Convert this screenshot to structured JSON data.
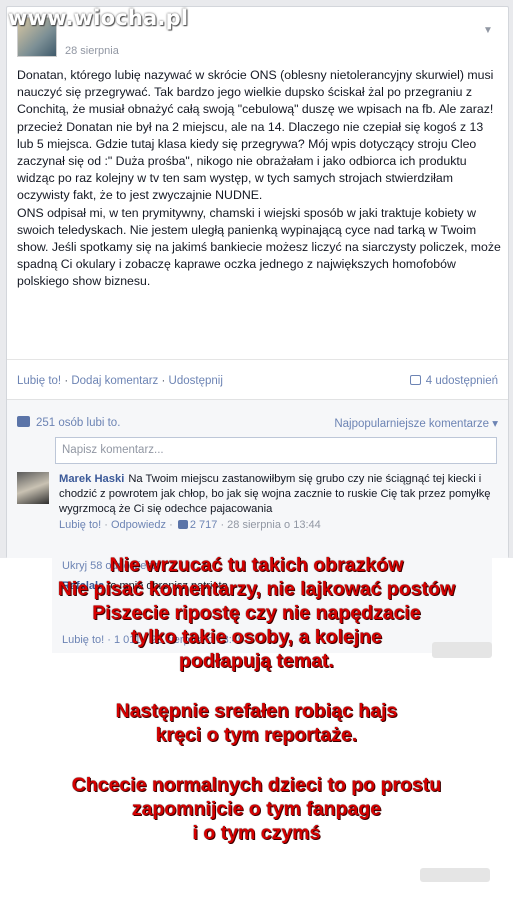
{
  "watermark": "www.wiocha.pl",
  "post": {
    "date": "28 sierpnia",
    "paragraphs": [
      "Donatan, którego lubię nazywać w skrócie ONS (oblesny nietolerancyjny skurwiel) musi nauczyć się przegrywać. Tak bardzo jego wielkie dupsko ściskał żal po przegraniu z Conchitą, że musiał obnażyć całą swoją \"cebulową\" duszę we wpisach na fb. Ale zaraz! przecież Donatan nie był na 2 miejscu, ale na 14. Dlaczego nie czepiał się kogoś z 13 lub 5 miejsca. Gdzie tutaj klasa kiedy się przegrywa? Mój wpis dotyczący stroju Cleo zaczynał się od :\" Duża prośba\", nikogo nie obrażałam i jako odbiorca ich produktu widząc po raz kolejny w tv ten sam występ, w tych samych strojach stwierdziłam oczywisty fakt, że to jest zwyczajnie NUDNE.",
      "ONS odpisał mi, w ten prymitywny, chamski i wiejski sposób w jaki traktuje kobiety w swoich teledyskach. Nie jestem uległą panienką wypinającą cyce nad tarką w Twoim show. Jeśli spotkamy się na jakimś bankiecie możesz liczyć na siarczysty policzek, może spadną Ci okulary i zobaczę kaprawe oczka jednego z największych homofobów polskiego show biznesu."
    ],
    "action_like": "Lubię to!",
    "action_comment": "Dodaj komentarz",
    "action_share": "Udostępnij",
    "shares": "4 udostępnień",
    "likes": "251 osób lubi to.",
    "sort": "Najpopularniejsze komentarze",
    "comment_placeholder": "Napisz komentarz..."
  },
  "comment": {
    "author": "Marek Haski",
    "text": "Na Twoim miejscu zastanowiłbym się grubo czy nie ściągnąć tej kiecki i chodzić z powrotem jak chłop, bo jak się wojna zacznie to ruskie Cię tak przez pomyłkę wygrzmocą że Ci się odechce pajacowania",
    "like": "Lubię to!",
    "reply": "Odpowiedz",
    "like_count": "2 717",
    "date": "28 sierpnia o 13:44"
  },
  "replies": {
    "hidden": "Ukryj 58 odpowiedzi",
    "author": "Rafalala",
    "text": "to mnie obronisz patrioto",
    "meta": "Lubię to! · 1 011 · 28 sierpnia o 13:49"
  },
  "overlay": {
    "lines_a": [
      "Nie wrzucać tu takich obrazków",
      "Nie pisać komentarzy, nie lajkować postów",
      "Piszecie ripostę czy nie napędzacie",
      "tylko takie osoby, a kolejne",
      "podłapują temat."
    ],
    "lines_b": [
      "Następnie srefałen robiąc hajs",
      "kręci o tym reportaże."
    ],
    "lines_c": [
      "Chcecie normalnych dzieci to po prostu",
      "zapomnijcie o tym fanpage",
      "i o tym czymś"
    ]
  }
}
